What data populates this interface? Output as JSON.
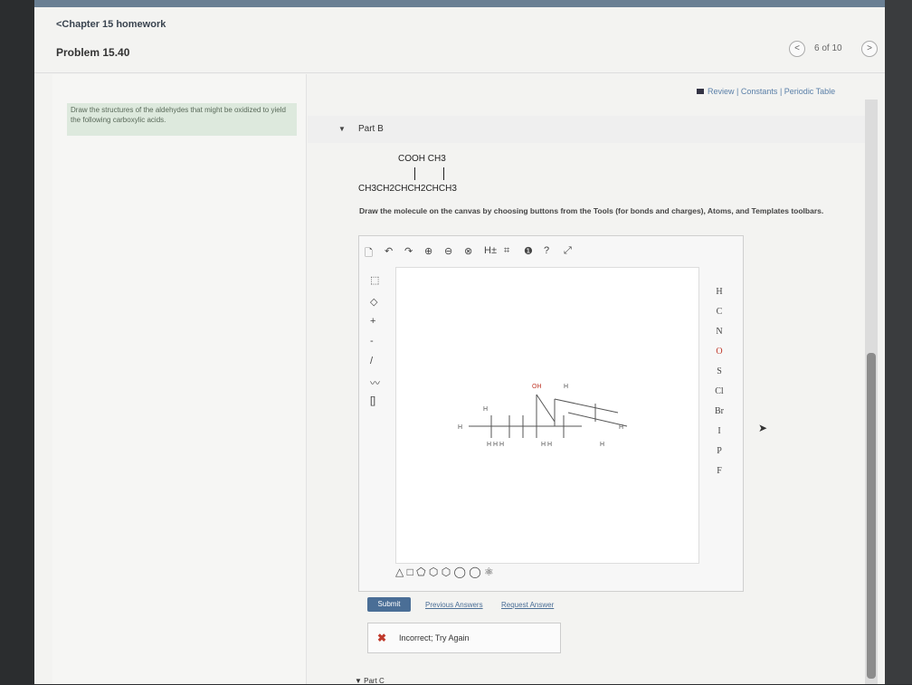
{
  "header": {
    "chapter_link": "<Chapter 15 homework",
    "problem_title": "Problem 15.40",
    "pager": {
      "prev": "<",
      "count": "6 of 10",
      "next": ">"
    }
  },
  "instruction": "Draw the structures of the aldehydes that might be oxidized to yield the following carboxylic acids.",
  "review_bar": {
    "review": "Review",
    "sep1": "|",
    "constants": "Constants",
    "sep2": "|",
    "periodic": "Periodic Table"
  },
  "part_b": {
    "label": "Part B",
    "formula_top": "COOH CH3",
    "formula_bottom": "CH3CH2CHCH2CHCH3",
    "directions": "Draw the molecule on the canvas by choosing buttons from the Tools (for bonds and charges), Atoms, and Templates toolbars."
  },
  "atoms": [
    "H",
    "C",
    "N",
    "O",
    "S",
    "Cl",
    "Br",
    "I",
    "P",
    "F"
  ],
  "toolbar_top": [
    "🗋",
    "↶",
    "↷",
    "⊕",
    "⊖",
    "⊗",
    "H±",
    "⌗",
    "❶",
    "?",
    "⤢"
  ],
  "templates": "△ □ ⬠ ⬡ ⬡ ◯ ◯ ⚛",
  "actions": {
    "submit": "Submit",
    "previous": "Previous Answers",
    "request": "Request Answer"
  },
  "feedback": {
    "icon": "✖",
    "message": "Incorrect; Try Again"
  },
  "part_c": {
    "label": "Part C"
  }
}
